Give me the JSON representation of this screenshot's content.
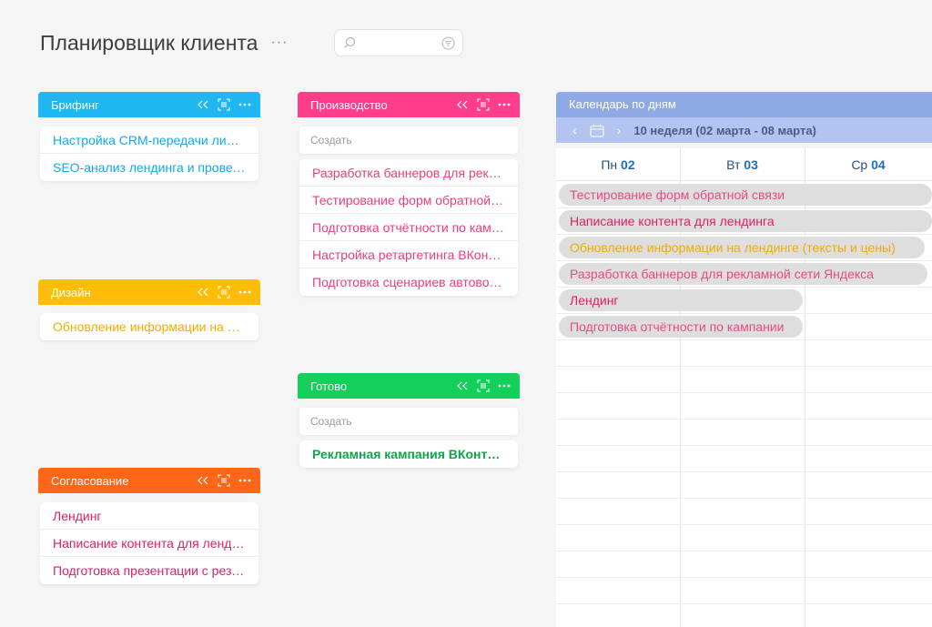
{
  "header": {
    "title": "Планировщик клиента",
    "more": "···"
  },
  "columns": {
    "briefing": {
      "title": "Брифинг",
      "color": "#1fb6f2",
      "cards": [
        "Настройка CRM-передачи лидов",
        "SEO-анализ лендинга и проведение"
      ],
      "card_color": "#13a8e8"
    },
    "design": {
      "title": "Дизайн",
      "color": "#ffbd08",
      "cards": [
        "Обновление информации на лендинге"
      ],
      "card_color": "#f1ac00"
    },
    "approval": {
      "title": "Согласование",
      "color": "#ff6617",
      "cards": [
        "Лендинг",
        "Написание контента для лендинга",
        "Подготовка презентации с результатами"
      ],
      "card_color": "#e01e64"
    },
    "production": {
      "title": "Производство",
      "color": "#ff3d8a",
      "create_label": "Создать",
      "cards": [
        "Разработка баннеров для рекламной сети",
        "Тестирование форм обратной связи",
        "Подготовка отчётности по кампании",
        "Настройка ретаргетинга ВКонтакте",
        "Подготовка сценариев автоворонки"
      ],
      "card_color": "#ea3e7d"
    },
    "done": {
      "title": "Готово",
      "color": "#12d05a",
      "create_label": "Создать",
      "cards": [
        "Рекламная кампания ВКонтакте"
      ],
      "card_color": "#10a648"
    }
  },
  "calendar": {
    "title": "Календарь по дням",
    "week_label": "10 неделя (02 марта - 08 марта)",
    "days": [
      {
        "name": "Пн",
        "num": "02"
      },
      {
        "name": "Вт",
        "num": "03"
      },
      {
        "name": "Ср",
        "num": "04"
      }
    ],
    "events": [
      {
        "label": "Тестирование форм обратной связи",
        "color": "#e64a86"
      },
      {
        "label": "Написание контента для лендинга",
        "color": "#e01e64"
      },
      {
        "label": "Обновление информации на лендинге (тексты и цены)",
        "color": "#f1ac00"
      },
      {
        "label": "Разработка баннеров для рекламной сети Яндекса",
        "color": "#e64a86"
      },
      {
        "label": "Лендинг",
        "color": "#e01e64"
      },
      {
        "label": "Подготовка отчётности по кампании",
        "color": "#e64a86"
      }
    ]
  }
}
